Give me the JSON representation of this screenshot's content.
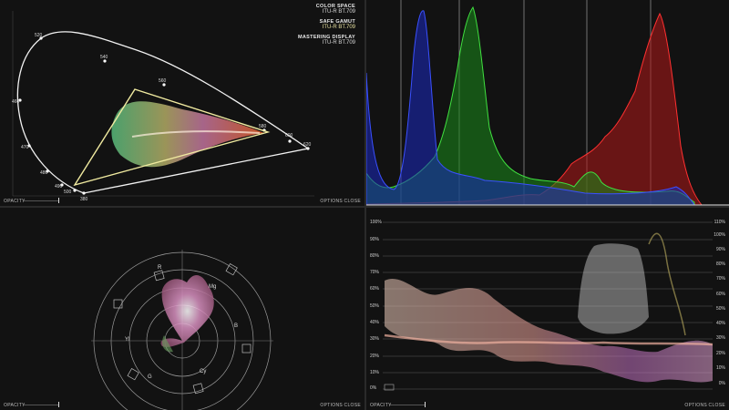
{
  "cie": {
    "color_space_label": "COLOR SPACE",
    "color_space_value": "ITU-R BT.709",
    "safe_gamut_label": "SAFE GAMUT",
    "safe_gamut_value": "ITU-R BT.709",
    "mastering_label": "MASTERING DISPLAY",
    "mastering_value": "ITU-R BT.709",
    "wavelengths": [
      "520",
      "540",
      "560",
      "580",
      "600",
      "620",
      "380",
      "460",
      "470",
      "480",
      "490",
      "500"
    ]
  },
  "vectorscope": {
    "targets": [
      "R",
      "Mg",
      "B",
      "Cy",
      "G",
      "Yl"
    ]
  },
  "waveform": {
    "left_ticks": [
      "100%",
      "90%",
      "80%",
      "70%",
      "60%",
      "50%",
      "40%",
      "30%",
      "20%",
      "10%",
      "0%"
    ],
    "right_ticks": [
      "110%",
      "100%",
      "90%",
      "80%",
      "70%",
      "60%",
      "50%",
      "40%",
      "30%",
      "20%",
      "10%",
      "0%"
    ]
  },
  "footer": {
    "opacity": "OPACITY",
    "options": "OPTIONS",
    "close": "CLOSE"
  },
  "colors": {
    "red": "#e02020",
    "green": "#2fd02f",
    "blue": "#2a3cf0",
    "gamut": "#f0eaa0"
  }
}
